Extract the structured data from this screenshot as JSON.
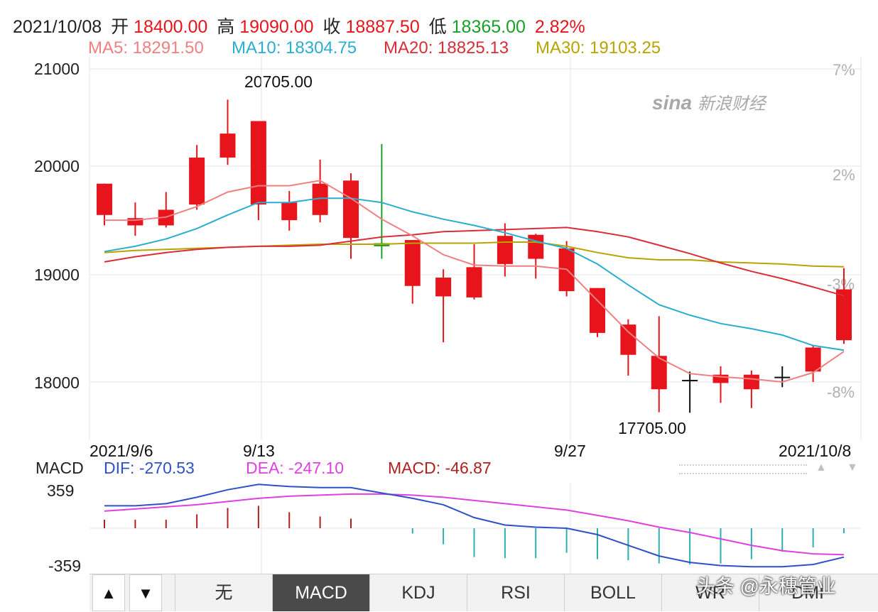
{
  "header": {
    "date": "2021/10/08",
    "open_label": "开",
    "open": "18400.00",
    "high_label": "高",
    "high": "19090.00",
    "close_label": "收",
    "close": "18887.50",
    "low_label": "低",
    "low": "18365.00",
    "change_pct": "2.82%"
  },
  "ma_row": {
    "ma5": "MA5: 18291.50",
    "ma10": "MA10: 18304.75",
    "ma20": "MA20: 18825.13",
    "ma30": "MA30: 19103.25"
  },
  "watermark": {
    "brand": "sina",
    "name": "新浪财经"
  },
  "colors": {
    "up": "#e8141c",
    "down": "#1aa028",
    "ma5": "#f08080",
    "ma10": "#2aaed0",
    "ma20": "#d92e3a",
    "ma30": "#b8a400",
    "dif": "#3050c8",
    "dea": "#e040e0",
    "macd_pos": "#b02020",
    "macd_neg": "#2ab0b0"
  },
  "chart_data": [
    {
      "type": "candlestick",
      "y_ticks": [
        "21000",
        "20000",
        "19000",
        "18000"
      ],
      "pct_ticks": [
        "7%",
        "2%",
        "-3%",
        "-8%"
      ],
      "ylim": [
        17600,
        21100
      ],
      "x_labels": [
        "2021/9/6",
        "9/13",
        "9/27",
        "2021/10/8"
      ],
      "annotations": {
        "max": "20705.00",
        "min": "17705.00"
      },
      "candles": [
        {
          "o": 19600,
          "c": 19900,
          "h": 19900,
          "l": 19500
        },
        {
          "o": 19500,
          "c": 19570,
          "h": 19720,
          "l": 19400
        },
        {
          "o": 19500,
          "c": 19650,
          "h": 19820,
          "l": 19480
        },
        {
          "o": 19700,
          "c": 20150,
          "h": 20270,
          "l": 19650
        },
        {
          "o": 20150,
          "c": 20380,
          "h": 20705,
          "l": 20080
        },
        {
          "o": 19700,
          "c": 20500,
          "h": 20500,
          "l": 19550
        },
        {
          "o": 19550,
          "c": 19720,
          "h": 19830,
          "l": 19450
        },
        {
          "o": 19600,
          "c": 19900,
          "h": 20130,
          "l": 19530
        },
        {
          "o": 19380,
          "c": 19930,
          "h": 20000,
          "l": 19180
        },
        {
          "o": 19330,
          "c": 19300,
          "h": 20280,
          "l": 19180
        },
        {
          "o": 18920,
          "c": 19360,
          "h": 19360,
          "l": 18750
        },
        {
          "o": 18820,
          "c": 19000,
          "h": 19080,
          "l": 18380
        },
        {
          "o": 18810,
          "c": 19100,
          "h": 19320,
          "l": 18790
        },
        {
          "o": 19130,
          "c": 19400,
          "h": 19520,
          "l": 19010
        },
        {
          "o": 19180,
          "c": 19410,
          "h": 19420,
          "l": 18990
        },
        {
          "o": 18870,
          "c": 19280,
          "h": 19350,
          "l": 18820
        },
        {
          "o": 18470,
          "c": 18900,
          "h": 18900,
          "l": 18430
        },
        {
          "o": 18260,
          "c": 18550,
          "h": 18600,
          "l": 18060
        },
        {
          "o": 17930,
          "c": 18250,
          "h": 18630,
          "l": 17710
        },
        {
          "o": 18020,
          "c": 18020,
          "h": 18100,
          "l": 17705
        },
        {
          "o": 17990,
          "c": 18070,
          "h": 18150,
          "l": 17800
        },
        {
          "o": 17930,
          "c": 18070,
          "h": 18110,
          "l": 17750
        },
        {
          "o": 18050,
          "c": 18050,
          "h": 18150,
          "l": 17950
        },
        {
          "o": 18100,
          "c": 18330,
          "h": 18350,
          "l": 18000
        },
        {
          "o": 18400,
          "c": 18887.5,
          "h": 19090,
          "l": 18365
        }
      ],
      "ma5": [
        19550,
        19550,
        19580,
        19680,
        19820,
        19880,
        19880,
        19930,
        19760,
        19560,
        19400,
        19220,
        19120,
        19110,
        19110,
        19080,
        18780,
        18480,
        18230,
        18080,
        18050,
        18030,
        18000,
        18090,
        18291.5
      ],
      "ma10": [
        19250,
        19300,
        19370,
        19470,
        19600,
        19720,
        19720,
        19760,
        19760,
        19720,
        19630,
        19560,
        19500,
        19430,
        19350,
        19280,
        19130,
        18930,
        18740,
        18640,
        18560,
        18510,
        18450,
        18350,
        18304.75
      ],
      "ma20": [
        19150,
        19200,
        19240,
        19270,
        19290,
        19300,
        19300,
        19310,
        19350,
        19390,
        19410,
        19440,
        19450,
        19460,
        19470,
        19480,
        19440,
        19390,
        19310,
        19230,
        19140,
        19060,
        18990,
        18910,
        18825.13
      ],
      "ma30": [
        19240,
        19260,
        19270,
        19280,
        19290,
        19300,
        19310,
        19320,
        19320,
        19320,
        19330,
        19330,
        19330,
        19340,
        19340,
        19300,
        19240,
        19190,
        19170,
        19170,
        19150,
        19140,
        19130,
        19110,
        19103.25
      ]
    },
    {
      "type": "macd",
      "label": "MACD",
      "dif": "DIF: -270.53",
      "dea": "DEA: -247.10",
      "macd": "MACD: -46.87",
      "y_ticks": [
        "359",
        "-359"
      ],
      "ylim": [
        -359,
        359
      ],
      "dif_values": [
        210,
        210,
        230,
        290,
        360,
        410,
        390,
        380,
        380,
        330,
        280,
        220,
        100,
        30,
        10,
        0,
        -60,
        -160,
        -260,
        -320,
        -350,
        -360,
        -360,
        -340,
        -270.53
      ],
      "dea_values": [
        160,
        180,
        200,
        220,
        250,
        280,
        300,
        310,
        320,
        320,
        310,
        290,
        260,
        230,
        200,
        170,
        120,
        70,
        10,
        -40,
        -100,
        -160,
        -210,
        -240,
        -247.1
      ],
      "hist_values": [
        80,
        80,
        80,
        130,
        190,
        210,
        150,
        110,
        90,
        0,
        -50,
        -150,
        -270,
        -280,
        -280,
        -230,
        -290,
        -300,
        -330,
        -340,
        -330,
        -290,
        -220,
        -180,
        -46.87
      ]
    }
  ],
  "tabs": {
    "up": "▲",
    "down": "▼",
    "items": [
      "无",
      "MACD",
      "KDJ",
      "RSI",
      "BOLL",
      "WR",
      "DMI"
    ],
    "active": "MACD"
  },
  "credit": "头条 @永穗管业"
}
